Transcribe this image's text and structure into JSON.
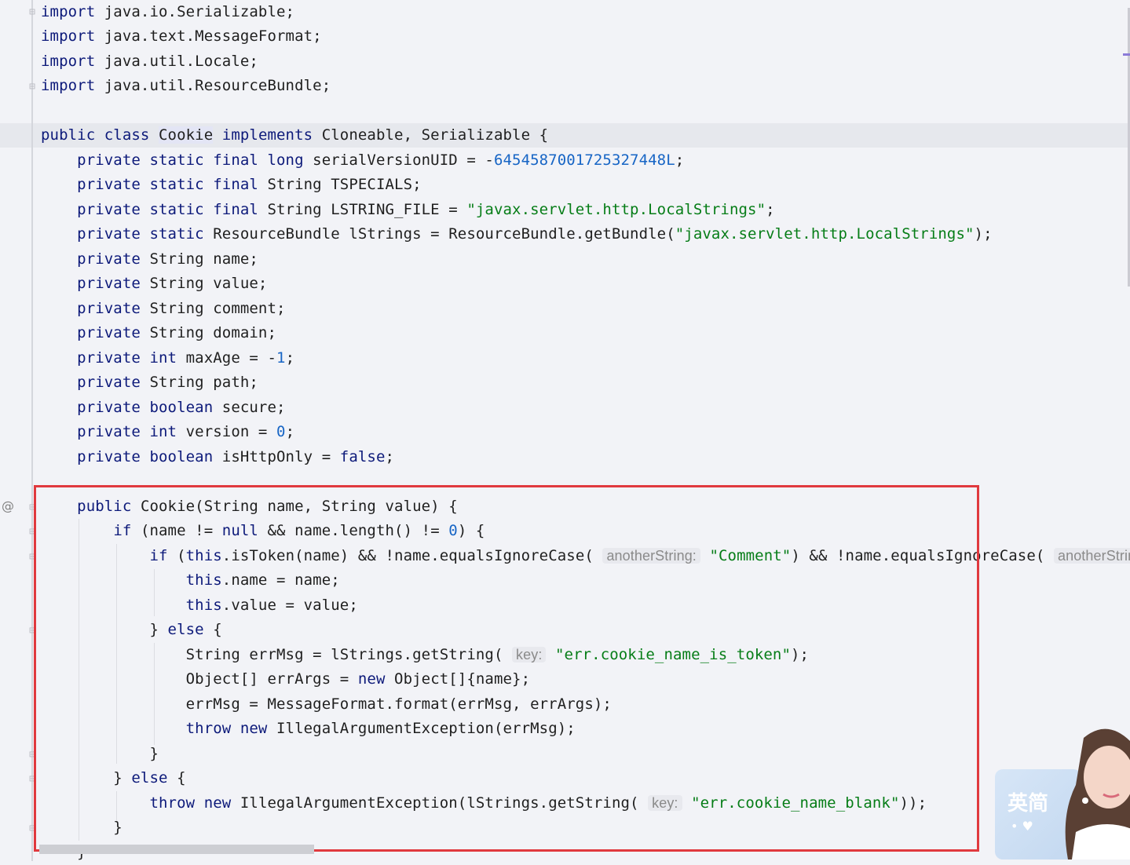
{
  "editor": {
    "language": "java",
    "lines": [
      {
        "segments": [
          {
            "t": "kw",
            "v": "import"
          },
          {
            "t": "",
            "v": " java.io.Serializable;"
          }
        ]
      },
      {
        "segments": [
          {
            "t": "kw",
            "v": "import"
          },
          {
            "t": "",
            "v": " java.text.MessageFormat;"
          }
        ]
      },
      {
        "segments": [
          {
            "t": "kw",
            "v": "import"
          },
          {
            "t": "",
            "v": " java.util.Locale;"
          }
        ]
      },
      {
        "segments": [
          {
            "t": "kw",
            "v": "import"
          },
          {
            "t": "",
            "v": " java.util.ResourceBundle;"
          }
        ]
      },
      {
        "segments": []
      },
      {
        "segments": [
          {
            "t": "kw",
            "v": "public class "
          },
          {
            "t": "cls",
            "v": "Cookie"
          },
          {
            "t": "kw",
            "v": " implements "
          },
          {
            "t": "",
            "v": "Cloneable, Serializable {"
          }
        ]
      },
      {
        "segments": [
          {
            "t": "",
            "v": "    "
          },
          {
            "t": "kw",
            "v": "private static final long "
          },
          {
            "t": "",
            "v": "serialVersionUID = -"
          },
          {
            "t": "num",
            "v": "6454587001725327448L"
          },
          {
            "t": "",
            "v": ";"
          }
        ]
      },
      {
        "segments": [
          {
            "t": "",
            "v": "    "
          },
          {
            "t": "kw",
            "v": "private static final "
          },
          {
            "t": "",
            "v": "String TSPECIALS;"
          }
        ]
      },
      {
        "segments": [
          {
            "t": "",
            "v": "    "
          },
          {
            "t": "kw",
            "v": "private static final "
          },
          {
            "t": "",
            "v": "String LSTRING_FILE = "
          },
          {
            "t": "str",
            "v": "\"javax.servlet.http.LocalStrings\""
          },
          {
            "t": "",
            "v": ";"
          }
        ]
      },
      {
        "segments": [
          {
            "t": "",
            "v": "    "
          },
          {
            "t": "kw",
            "v": "private static "
          },
          {
            "t": "",
            "v": "ResourceBundle lStrings = ResourceBundle.getBundle("
          },
          {
            "t": "str",
            "v": "\"javax.servlet.http.LocalStrings\""
          },
          {
            "t": "",
            "v": ");"
          }
        ]
      },
      {
        "segments": [
          {
            "t": "",
            "v": "    "
          },
          {
            "t": "kw",
            "v": "private "
          },
          {
            "t": "",
            "v": "String name;"
          }
        ]
      },
      {
        "segments": [
          {
            "t": "",
            "v": "    "
          },
          {
            "t": "kw",
            "v": "private "
          },
          {
            "t": "",
            "v": "String value;"
          }
        ]
      },
      {
        "segments": [
          {
            "t": "",
            "v": "    "
          },
          {
            "t": "kw",
            "v": "private "
          },
          {
            "t": "",
            "v": "String comment;"
          }
        ]
      },
      {
        "segments": [
          {
            "t": "",
            "v": "    "
          },
          {
            "t": "kw",
            "v": "private "
          },
          {
            "t": "",
            "v": "String domain;"
          }
        ]
      },
      {
        "segments": [
          {
            "t": "",
            "v": "    "
          },
          {
            "t": "kw",
            "v": "private int "
          },
          {
            "t": "",
            "v": "maxAge = -"
          },
          {
            "t": "num",
            "v": "1"
          },
          {
            "t": "",
            "v": ";"
          }
        ]
      },
      {
        "segments": [
          {
            "t": "",
            "v": "    "
          },
          {
            "t": "kw",
            "v": "private "
          },
          {
            "t": "",
            "v": "String path;"
          }
        ]
      },
      {
        "segments": [
          {
            "t": "",
            "v": "    "
          },
          {
            "t": "kw",
            "v": "private boolean "
          },
          {
            "t": "",
            "v": "secure;"
          }
        ]
      },
      {
        "segments": [
          {
            "t": "",
            "v": "    "
          },
          {
            "t": "kw",
            "v": "private int "
          },
          {
            "t": "",
            "v": "version = "
          },
          {
            "t": "num",
            "v": "0"
          },
          {
            "t": "",
            "v": ";"
          }
        ]
      },
      {
        "segments": [
          {
            "t": "",
            "v": "    "
          },
          {
            "t": "kw",
            "v": "private boolean "
          },
          {
            "t": "",
            "v": "isHttpOnly = "
          },
          {
            "t": "kw",
            "v": "false"
          },
          {
            "t": "",
            "v": ";"
          }
        ]
      },
      {
        "segments": []
      },
      {
        "segments": [
          {
            "t": "",
            "v": "    "
          },
          {
            "t": "kw",
            "v": "public "
          },
          {
            "t": "",
            "v": "Cookie(String name, String value) {"
          }
        ]
      },
      {
        "segments": [
          {
            "t": "",
            "v": "        "
          },
          {
            "t": "kw",
            "v": "if "
          },
          {
            "t": "",
            "v": "(name != "
          },
          {
            "t": "kw",
            "v": "null"
          },
          {
            "t": "",
            "v": " && name.length() != "
          },
          {
            "t": "num",
            "v": "0"
          },
          {
            "t": "",
            "v": ") {"
          }
        ]
      },
      {
        "segments": [
          {
            "t": "",
            "v": "            "
          },
          {
            "t": "kw",
            "v": "if "
          },
          {
            "t": "",
            "v": "("
          },
          {
            "t": "kw",
            "v": "this"
          },
          {
            "t": "",
            "v": ".isToken(name) && !name.equalsIgnoreCase( "
          },
          {
            "t": "hint",
            "v": "anotherString:"
          },
          {
            "t": "",
            "v": " "
          },
          {
            "t": "str",
            "v": "\"Comment\""
          },
          {
            "t": "",
            "v": ") && !name.equalsIgnoreCase( "
          },
          {
            "t": "hint",
            "v": "anotherString:"
          }
        ]
      },
      {
        "segments": [
          {
            "t": "",
            "v": "                "
          },
          {
            "t": "kw",
            "v": "this"
          },
          {
            "t": "",
            "v": ".name = name;"
          }
        ]
      },
      {
        "segments": [
          {
            "t": "",
            "v": "                "
          },
          {
            "t": "kw",
            "v": "this"
          },
          {
            "t": "",
            "v": ".value = value;"
          }
        ]
      },
      {
        "segments": [
          {
            "t": "",
            "v": "            } "
          },
          {
            "t": "kw",
            "v": "else"
          },
          {
            "t": "",
            "v": " {"
          }
        ]
      },
      {
        "segments": [
          {
            "t": "",
            "v": "                String errMsg = lStrings.getString( "
          },
          {
            "t": "hint",
            "v": "key:"
          },
          {
            "t": "",
            "v": " "
          },
          {
            "t": "str",
            "v": "\"err.cookie_name_is_token\""
          },
          {
            "t": "",
            "v": ");"
          }
        ]
      },
      {
        "segments": [
          {
            "t": "",
            "v": "                Object[] errArgs = "
          },
          {
            "t": "kw",
            "v": "new"
          },
          {
            "t": "",
            "v": " Object[]{name};"
          }
        ]
      },
      {
        "segments": [
          {
            "t": "",
            "v": "                errMsg = MessageFormat.format(errMsg, errArgs);"
          }
        ]
      },
      {
        "segments": [
          {
            "t": "",
            "v": "                "
          },
          {
            "t": "kw",
            "v": "throw new"
          },
          {
            "t": "",
            "v": " IllegalArgumentException(errMsg);"
          }
        ]
      },
      {
        "segments": [
          {
            "t": "",
            "v": "            }"
          }
        ]
      },
      {
        "segments": [
          {
            "t": "",
            "v": "        } "
          },
          {
            "t": "kw",
            "v": "else"
          },
          {
            "t": "",
            "v": " {"
          }
        ]
      },
      {
        "segments": [
          {
            "t": "",
            "v": "            "
          },
          {
            "t": "kw",
            "v": "throw new"
          },
          {
            "t": "",
            "v": " IllegalArgumentException(lStrings.getString( "
          },
          {
            "t": "hint",
            "v": "key:"
          },
          {
            "t": "",
            "v": " "
          },
          {
            "t": "str",
            "v": "\"err.cookie_name_blank\""
          },
          {
            "t": "",
            "v": "));"
          }
        ]
      },
      {
        "segments": [
          {
            "t": "",
            "v": "        }"
          }
        ]
      },
      {
        "segments": [
          {
            "t": "",
            "v": "    }"
          }
        ]
      }
    ],
    "gutter_marker": "@",
    "colors": {
      "keyword": "#0d1a7a",
      "number": "#1765c5",
      "string": "#067d17",
      "hint": "#8a8a8a",
      "highlight_box": "#e0393e",
      "background": "#f2f3f7"
    }
  },
  "ad_widget": {
    "label": "英简",
    "dots": "• ♥"
  }
}
